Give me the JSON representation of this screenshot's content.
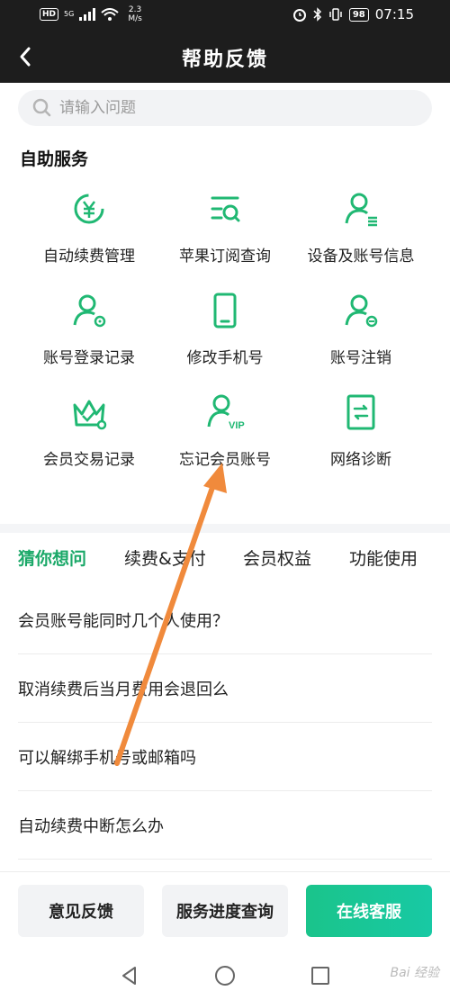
{
  "status_bar": {
    "hd": "HD",
    "network": "5G",
    "speed_value": "2.3",
    "speed_unit": "M/s",
    "battery": "98",
    "time": "07:15"
  },
  "header": {
    "title": "帮助反馈"
  },
  "search": {
    "placeholder": "请输入问题"
  },
  "self_service": {
    "title": "自助服务",
    "items": [
      {
        "label": "自动续费管理",
        "icon": "auto-renew-icon"
      },
      {
        "label": "苹果订阅查询",
        "icon": "subscription-search-icon"
      },
      {
        "label": "设备及账号信息",
        "icon": "user-info-icon"
      },
      {
        "label": "账号登录记录",
        "icon": "login-record-icon"
      },
      {
        "label": "修改手机号",
        "icon": "phone-icon"
      },
      {
        "label": "账号注销",
        "icon": "account-cancel-icon"
      },
      {
        "label": "会员交易记录",
        "icon": "member-crown-icon"
      },
      {
        "label": "忘记会员账号",
        "icon": "vip-user-icon"
      },
      {
        "label": "网络诊断",
        "icon": "network-diagnose-icon"
      }
    ]
  },
  "tabs": [
    {
      "label": "猜你想问",
      "active": true
    },
    {
      "label": "续费&支付",
      "active": false
    },
    {
      "label": "会员权益",
      "active": false
    },
    {
      "label": "功能使用",
      "active": false
    }
  ],
  "faq": [
    "会员账号能同时几个人使用？",
    "取消续费后当月费用会退回么",
    "可以解绑手机号或邮箱吗",
    "自动续费中断怎么办"
  ],
  "actions": {
    "feedback": "意见反馈",
    "progress": "服务进度查询",
    "online_service": "在线客服"
  },
  "colors": {
    "accent": "#1aa868",
    "primary_btn": "#1ac48b",
    "annotation_arrow": "#f08a3c"
  },
  "watermark": "Bai 经验"
}
